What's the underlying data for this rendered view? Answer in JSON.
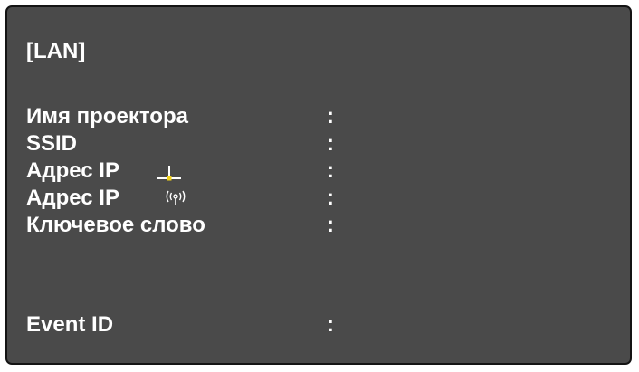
{
  "section_title": "[LAN]",
  "rows": [
    {
      "label": "Имя проектора",
      "separator": ":",
      "value": ""
    },
    {
      "label": "SSID",
      "separator": ":",
      "value": ""
    },
    {
      "label": "Адрес IP",
      "icon": "wired-lan-icon",
      "separator": ":",
      "value": ""
    },
    {
      "label": "Адрес IP",
      "icon": "wireless-lan-icon",
      "separator": ":",
      "value": ""
    },
    {
      "label": "Ключевое слово",
      "separator": ":",
      "value": ""
    },
    {
      "label": "Event ID",
      "separator": ":",
      "value": ""
    }
  ],
  "colors": {
    "panel_background": "#4a4a4a",
    "panel_border": "#141414",
    "text": "#ffffff",
    "wired_indicator": "#f2d21a"
  }
}
